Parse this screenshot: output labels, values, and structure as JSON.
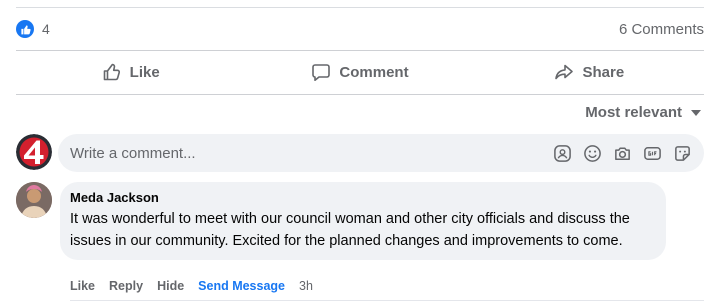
{
  "post_stats": {
    "reaction_count": "4",
    "comments_label": "6 Comments"
  },
  "actions": {
    "like": "Like",
    "comment": "Comment",
    "share": "Share"
  },
  "sort": {
    "label": "Most relevant"
  },
  "composer": {
    "placeholder": "Write a comment..."
  },
  "comments": [
    {
      "author": "Meda Jackson",
      "text": "It was wonderful to meet with our council woman and other city officials and discuss the issues in our community. Excited for the planned changes and improvements to come.",
      "actions": {
        "like": "Like",
        "reply": "Reply",
        "hide": "Hide",
        "send_message": "Send Message"
      },
      "time": "3h"
    }
  ],
  "colors": {
    "accent": "#1877f2",
    "muted_text": "#65676b",
    "bubble_bg": "#f0f2f5",
    "logo_red": "#d3202e"
  }
}
